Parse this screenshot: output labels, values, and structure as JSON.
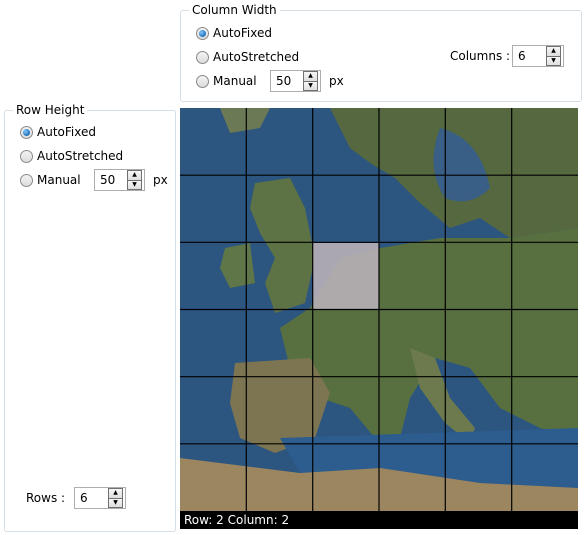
{
  "column_width": {
    "legend": "Column Width",
    "options": [
      "AutoFixed",
      "AutoStretched",
      "Manual"
    ],
    "selected": "AutoFixed",
    "manual_value": "50",
    "unit": "px",
    "columns_label": "Columns :",
    "columns_value": "6"
  },
  "row_height": {
    "legend": "Row Height",
    "options": [
      "AutoFixed",
      "AutoStretched",
      "Manual"
    ],
    "selected": "AutoFixed",
    "manual_value": "50",
    "unit": "px",
    "rows_label": "Rows :",
    "rows_value": "6"
  },
  "map": {
    "columns": 6,
    "rows": 6,
    "selected_row": 2,
    "selected_column": 2
  },
  "status": {
    "row_label": "Row:",
    "row_value": "2",
    "column_label": "Column:",
    "column_value": "2"
  },
  "colors": {
    "group_border": "#d5dfe5",
    "grid_line": "#000000",
    "selected_tile": "#b8b0b8",
    "status_bg": "#000000",
    "status_fg": "#ffffff"
  }
}
